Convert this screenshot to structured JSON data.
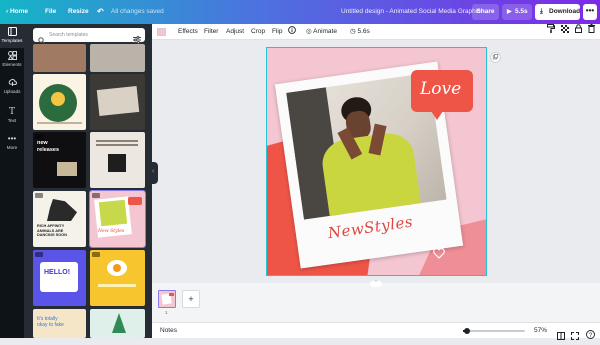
{
  "topbar": {
    "home": "Home",
    "file": "File",
    "resize": "Resize",
    "saved_status": "All changes saved",
    "doc_title": "Untitled design - Animated Social Media Graphic",
    "share": "Share",
    "play_duration": "5.5s",
    "download": "Download",
    "more": "•••"
  },
  "rail": [
    {
      "label": "Templates",
      "icon": "templates-icon"
    },
    {
      "label": "Elements",
      "icon": "elements-icon"
    },
    {
      "label": "Uploads",
      "icon": "uploads-icon"
    },
    {
      "label": "Text",
      "icon": "text-icon"
    },
    {
      "label": "More",
      "icon": "more-icon"
    }
  ],
  "templates_panel": {
    "search_placeholder": "Search templates",
    "thumb_texts": {
      "new_releases": "new\nreleases",
      "rich_text": "RICH AFFINITY\nANIMALS ARE\nDANCING SOON",
      "hello": "HELLO!",
      "its_totally": "It's totally\nokay to fake",
      "new_styles": "New Styles"
    }
  },
  "toolbar": {
    "color": "#f7c3cc",
    "effects": "Effects",
    "filter": "Filter",
    "adjust": "Adjust",
    "crop": "Crop",
    "flip": "Flip",
    "animate": "Animate",
    "duration": "5.6s"
  },
  "design": {
    "bubble_text": "Love",
    "caption": "NewStyles",
    "background": "#f4c6d1",
    "accent": "#ef5547"
  },
  "bottombar": {
    "notes": "Notes",
    "zoom": "57%",
    "page_number": "1"
  }
}
